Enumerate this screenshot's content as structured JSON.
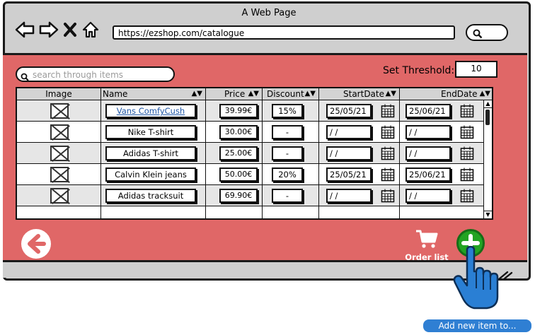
{
  "window": {
    "title": "A Web Page"
  },
  "browser": {
    "url": "https://ezshop.com/catalogue",
    "icons": [
      "back-arrow-icon",
      "forward-arrow-icon",
      "close-icon",
      "home-icon",
      "search-icon"
    ]
  },
  "search": {
    "placeholder": "search through items"
  },
  "threshold": {
    "label": "Set Threshold:",
    "value": "10"
  },
  "table": {
    "headers": {
      "image": "Image",
      "name": "Name",
      "price": "Price",
      "discount": "Discount",
      "start": "StartDate",
      "end": "EndDate"
    },
    "rows": [
      {
        "name": "Vans ComfyCush",
        "price": "39.99€",
        "discount": "15%",
        "start": "25/05/21",
        "end": "25/06/21"
      },
      {
        "name": "Nike T-shirt",
        "price": "30.00€",
        "discount": "-",
        "start": "/ /",
        "end": "/ /"
      },
      {
        "name": "Adidas T-shirt",
        "price": "25.00€",
        "discount": "-",
        "start": "/ /",
        "end": "/ /"
      },
      {
        "name": "Calvin Klein jeans",
        "price": "50.00€",
        "discount": "20%",
        "start": "25/05/21",
        "end": "25/06/21"
      },
      {
        "name": "Adidas tracksuit",
        "price": "69.90€",
        "discount": "-",
        "start": "/ /",
        "end": "/ /"
      }
    ]
  },
  "actions": {
    "order_label": "Order list"
  },
  "tooltip": {
    "text": "Add new item to..."
  },
  "colors": {
    "content_bg": "#e06767",
    "add_button": "#23a323",
    "tooltip": "#2f7fd3",
    "link": "#1f56a6"
  }
}
